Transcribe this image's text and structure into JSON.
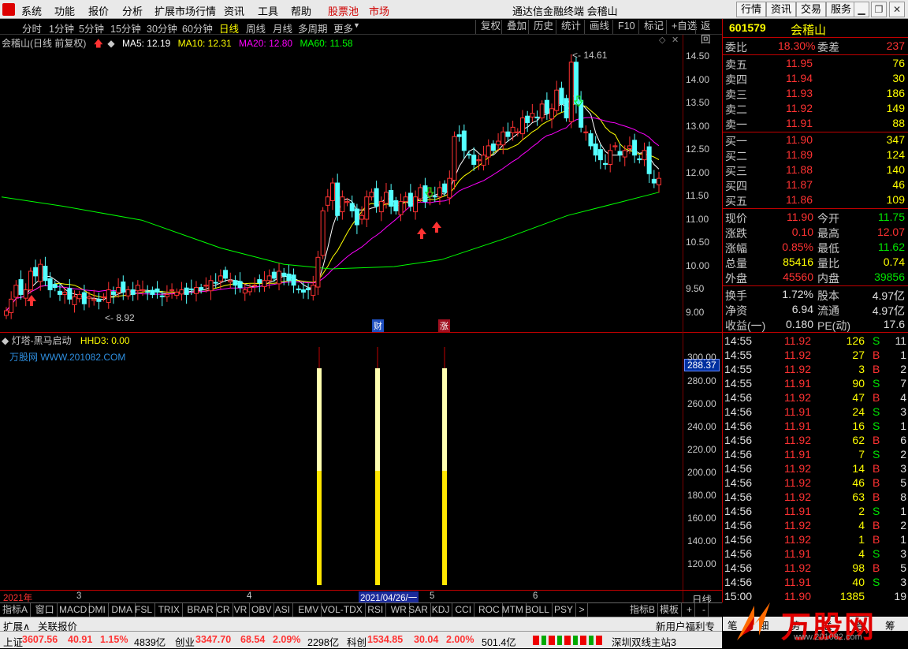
{
  "menu": {
    "items": [
      "系统",
      "功能",
      "报价",
      "分析",
      "扩展市场行情",
      "资讯",
      "工具",
      "帮助"
    ],
    "hot1": "股票池",
    "hot2": "市场",
    "app_title": "通达信金融终端 会稽山",
    "right_buttons": [
      "行情",
      "资讯",
      "交易",
      "服务"
    ]
  },
  "periods": [
    "分时",
    "1分钟",
    "5分钟",
    "15分钟",
    "30分钟",
    "60分钟",
    "日线",
    "周线",
    "月线",
    "多周期",
    "更多"
  ],
  "active_period": "日线",
  "tools": [
    "复权",
    "叠加",
    "历史",
    "统计",
    "画线",
    "F10",
    "标记",
    "+自选",
    "返回"
  ],
  "chart": {
    "name": "会稽山(日线 前复权)",
    "ma5": "MA5: 12.19",
    "ma10": "MA10: 12.31",
    "ma20": "MA20: 12.80",
    "ma60": "MA60: 11.58",
    "high_label": "14.61",
    "low_label": "8.92",
    "badge1": "财",
    "badge2": "涨",
    "colors": {
      "ma5": "#ffffff",
      "ma10": "#ffff00",
      "ma20": "#ff00ff",
      "ma60": "#00ff00",
      "up": "#ff3232",
      "down": "#54ffff"
    }
  },
  "price_axis": [
    "14.50",
    "14.00",
    "13.50",
    "13.00",
    "12.50",
    "12.00",
    "11.50",
    "11.00",
    "10.50",
    "10.00",
    "9.50",
    "9.00"
  ],
  "indicator": {
    "name": "灯塔-黑马启动",
    "value": "HHD3: 0.00",
    "watermark": "万股网 WWW.201082.COM",
    "current_label": "288.37",
    "axis": [
      "300.00",
      "280.00",
      "260.00",
      "240.00",
      "220.00",
      "200.00",
      "180.00",
      "160.00",
      "140.00",
      "120.00"
    ]
  },
  "timeline": {
    "labels": [
      "2021年",
      "3",
      "4",
      "2021/04/26/一",
      "5",
      "6"
    ],
    "period_label": "日线"
  },
  "indicator_tabs": [
    "指标A",
    "窗口",
    "MACD",
    "DMI",
    "DMA",
    "FSL",
    "TRIX",
    "BRAR",
    "CR",
    "VR",
    "OBV",
    "ASI",
    "EMV",
    "VOL-TDX",
    "RSI",
    "WR",
    "SAR",
    "KDJ",
    "CCI",
    "ROC",
    "MTM",
    "BOLL",
    "PSY"
  ],
  "indicator_tabs_right": [
    "指标B",
    "模板",
    "+",
    "-"
  ],
  "bottom": {
    "left1": "扩展∧",
    "left2": "关联报价",
    "right": "新用户福利专享"
  },
  "status": {
    "sh_label": "上证",
    "sh_value": "3607.56",
    "sh_change": "40.91",
    "sh_pct": "1.15%",
    "sh_amount": "4839亿",
    "cy_label": "创业",
    "cy_value": "3347.70",
    "cy_change": "68.54",
    "cy_pct": "2.09%",
    "cy_amount": "2298亿",
    "kc_label": "科创",
    "kc_value": "1534.85",
    "kc_change": "30.04",
    "kc_pct": "2.00%",
    "kc_amount": "501.4亿",
    "server": "深圳双线主站3"
  },
  "quote": {
    "code": "601579",
    "name": "会稽山",
    "weibi_label": "委比",
    "weibi": "18.30%",
    "weicha_label": "委差",
    "weicha": "237",
    "asks": [
      {
        "label": "卖五",
        "price": "11.95",
        "vol": "76"
      },
      {
        "label": "卖四",
        "price": "11.94",
        "vol": "30"
      },
      {
        "label": "卖三",
        "price": "11.93",
        "vol": "186"
      },
      {
        "label": "卖二",
        "price": "11.92",
        "vol": "149"
      },
      {
        "label": "卖一",
        "price": "11.91",
        "vol": "88"
      }
    ],
    "bids": [
      {
        "label": "买一",
        "price": "11.90",
        "vol": "347"
      },
      {
        "label": "买二",
        "price": "11.89",
        "vol": "124"
      },
      {
        "label": "买三",
        "price": "11.88",
        "vol": "140"
      },
      {
        "label": "买四",
        "price": "11.87",
        "vol": "46"
      },
      {
        "label": "买五",
        "price": "11.86",
        "vol": "109"
      }
    ],
    "stats": [
      {
        "l1": "现价",
        "v1": "11.90",
        "l2": "今开",
        "v2": "11.75"
      },
      {
        "l1": "涨跌",
        "v1": "0.10",
        "l2": "最高",
        "v2": "12.07"
      },
      {
        "l1": "涨幅",
        "v1": "0.85%",
        "l2": "最低",
        "v2": "11.62"
      },
      {
        "l1": "总量",
        "v1": "85416",
        "l2": "量比",
        "v2": "0.74"
      },
      {
        "l1": "外盘",
        "v1": "45560",
        "l2": "内盘",
        "v2": "39856"
      },
      {
        "l1": "换手",
        "v1": "1.72%",
        "l2": "股本",
        "v2": "4.97亿"
      },
      {
        "l1": "净资",
        "v1": "6.94",
        "l2": "流通",
        "v2": "4.97亿"
      },
      {
        "l1": "收益(一)",
        "v1": "0.180",
        "l2": "PE(动)",
        "v2": "17.6"
      }
    ],
    "ticks": [
      {
        "t": "14:55",
        "p": "11.92",
        "v": "126",
        "s": "S",
        "n": "11"
      },
      {
        "t": "14:55",
        "p": "11.92",
        "v": "27",
        "s": "B",
        "n": "1"
      },
      {
        "t": "14:55",
        "p": "11.92",
        "v": "3",
        "s": "B",
        "n": "2"
      },
      {
        "t": "14:55",
        "p": "11.91",
        "v": "90",
        "s": "S",
        "n": "7"
      },
      {
        "t": "14:56",
        "p": "11.92",
        "v": "47",
        "s": "B",
        "n": "4"
      },
      {
        "t": "14:56",
        "p": "11.91",
        "v": "24",
        "s": "S",
        "n": "3"
      },
      {
        "t": "14:56",
        "p": "11.91",
        "v": "16",
        "s": "S",
        "n": "1"
      },
      {
        "t": "14:56",
        "p": "11.92",
        "v": "62",
        "s": "B",
        "n": "6"
      },
      {
        "t": "14:56",
        "p": "11.91",
        "v": "7",
        "s": "S",
        "n": "2"
      },
      {
        "t": "14:56",
        "p": "11.92",
        "v": "14",
        "s": "B",
        "n": "3"
      },
      {
        "t": "14:56",
        "p": "11.92",
        "v": "46",
        "s": "B",
        "n": "5"
      },
      {
        "t": "14:56",
        "p": "11.92",
        "v": "63",
        "s": "B",
        "n": "8"
      },
      {
        "t": "14:56",
        "p": "11.91",
        "v": "2",
        "s": "S",
        "n": "1"
      },
      {
        "t": "14:56",
        "p": "11.92",
        "v": "4",
        "s": "B",
        "n": "2"
      },
      {
        "t": "14:56",
        "p": "11.92",
        "v": "1",
        "s": "B",
        "n": "1"
      },
      {
        "t": "14:56",
        "p": "11.91",
        "v": "4",
        "s": "S",
        "n": "3"
      },
      {
        "t": "14:56",
        "p": "11.92",
        "v": "98",
        "s": "B",
        "n": "5"
      },
      {
        "t": "14:56",
        "p": "11.91",
        "v": "40",
        "s": "S",
        "n": "3"
      },
      {
        "t": "15:00",
        "p": "11.90",
        "v": "1385",
        "s": "",
        "n": "19"
      }
    ]
  },
  "side_tabs": [
    "笔",
    "细",
    "势",
    "联",
    "值",
    "筹"
  ],
  "logo": {
    "text": "万股网",
    "url": "www.201082.com"
  }
}
